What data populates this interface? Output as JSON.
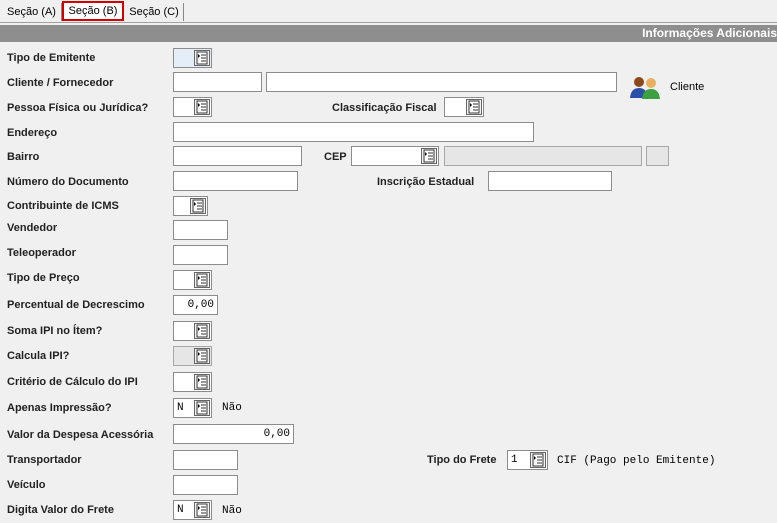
{
  "tabs": [
    "Seção (A)",
    "Seção (B)",
    "Seção (C)"
  ],
  "header": "Informações Adicionais",
  "labels": {
    "tipo_emitente": "Tipo de Emitente",
    "cliente_fornecedor": "Cliente / Fornecedor",
    "pessoa": "Pessoa Física ou Jurídica?",
    "classificacao_fiscal": "Classificação Fiscal",
    "endereco": "Endereço",
    "bairro": "Bairro",
    "cep": "CEP",
    "numero_documento": "Número do Documento",
    "inscricao_estadual": "Inscrição Estadual",
    "contribuinte_icms": "Contribuinte de ICMS",
    "vendedor": "Vendedor",
    "teleoperador": "Teleoperador",
    "tipo_preco": "Tipo de Preço",
    "percentual_decrescimo": "Percentual de Decrescimo",
    "soma_ipi": "Soma IPI no Ítem?",
    "calcula_ipi": "Calcula IPI?",
    "criterio_ipi": "Critério de Cálculo do IPI",
    "apenas_impressao": "Apenas Impressão?",
    "valor_despesa": "Valor da Despesa Acessória",
    "transportador": "Transportador",
    "tipo_frete": "Tipo do Frete",
    "veiculo": "Veículo",
    "digita_frete": "Digita Valor do Frete"
  },
  "values": {
    "percentual_decrescimo": "0,00",
    "apenas_impressao": "N",
    "apenas_impressao_desc": "Não",
    "valor_despesa": "0,00",
    "tipo_frete": "1",
    "tipo_frete_desc": "CIF (Pago pelo Emitente)",
    "digita_frete": "N",
    "digita_frete_desc": "Não"
  },
  "client_button": "Cliente",
  "icons": {
    "lookup": "list-lookup-icon",
    "client": "users-icon"
  }
}
